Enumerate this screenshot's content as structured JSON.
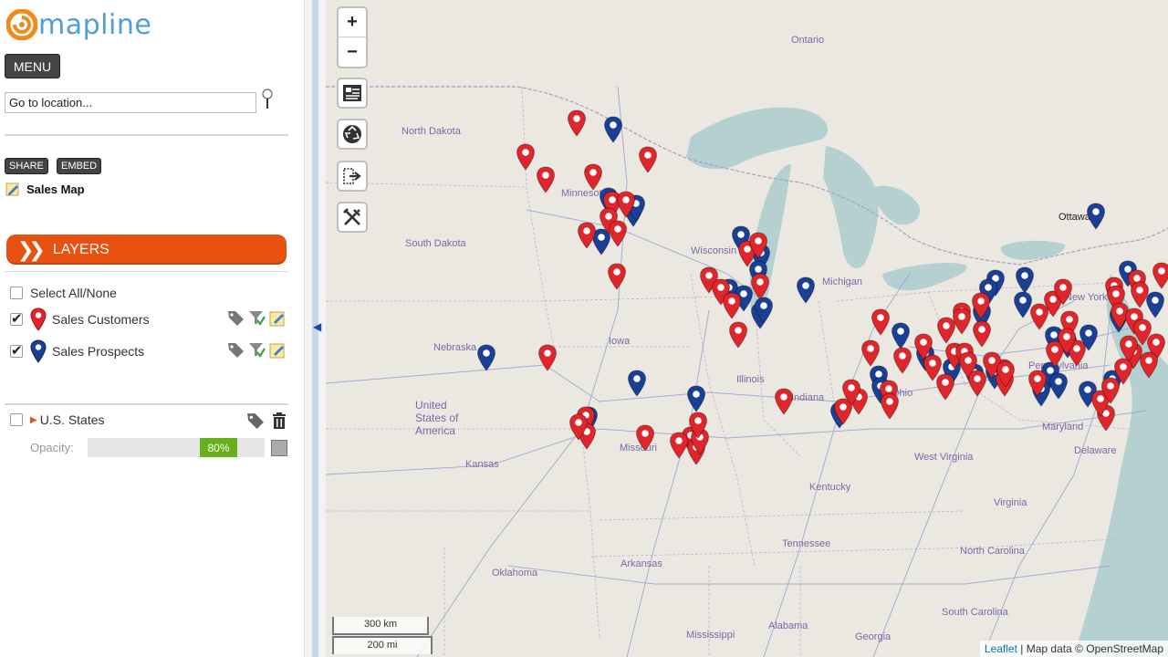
{
  "app": {
    "brand": "mapline",
    "brand_color": "#4f9fd4",
    "accent_color": "#e8510f"
  },
  "sidebar": {
    "menu_label": "MENU",
    "goto_placeholder": "Go to location...",
    "share_label": "SHARE",
    "embed_label": "EMBED",
    "map_title": "Sales Map",
    "layers_title": "LAYERS",
    "select_all_label": "Select All/None",
    "layers": [
      {
        "label": "Sales Customers",
        "checked": true,
        "pin_color": "#e0262b"
      },
      {
        "label": "Sales Prospects",
        "checked": true,
        "pin_color": "#1b3f94"
      }
    ],
    "states_layer": {
      "label": "U.S. States",
      "checked": false,
      "opacity_label": "Opacity:",
      "opacity_value": "80%"
    }
  },
  "map": {
    "zoom_in": "+",
    "zoom_out": "−",
    "scale_km": "300 km",
    "scale_mi": "200 mi",
    "attribution_leaflet": "Leaflet",
    "attribution_text": "| Map data © OpenStreetMap",
    "labels": [
      "Ontario",
      "North Dakota",
      "Minnesota",
      "South Dakota",
      "Wisconsin",
      "Michigan",
      "Nebraska",
      "Iowa",
      "United States of America",
      "Illinois",
      "Indiana",
      "Ohio",
      "Missouri",
      "Kansas",
      "Kentucky",
      "West Virginia",
      "Virginia",
      "North Carolina",
      "Tennessee",
      "Arkansas",
      "Oklahoma",
      "Mississippi",
      "Alabama",
      "Georgia",
      "Ottawa",
      "Pennsylvania",
      "New York",
      "Maryland",
      "Delaware",
      "South Carolina"
    ],
    "customer_color": "#e0262b",
    "prospect_color": "#1b3f94",
    "marker_counts": {
      "customers_visible": "many",
      "prospects_visible": "many"
    }
  }
}
